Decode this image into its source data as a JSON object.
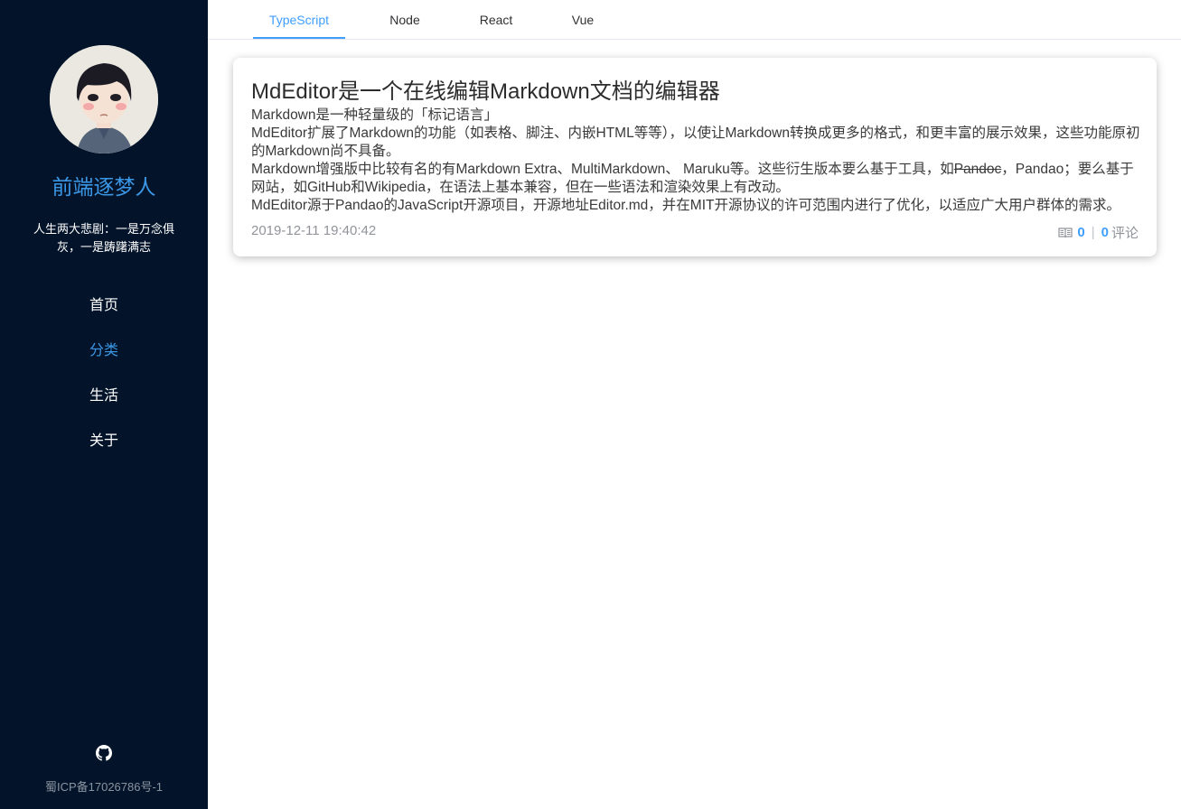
{
  "sidebar": {
    "site_name": "前端逐梦人",
    "motto": "人生两大悲剧：一是万念俱灰，一是踌躇满志",
    "nav": [
      "首页",
      "分类",
      "生活",
      "关于"
    ],
    "active_nav": "分类",
    "icp": "蜀ICP备17026786号-1",
    "github_icon": "github-icon"
  },
  "tabs": {
    "items": [
      "TypeScript",
      "Node",
      "React",
      "Vue"
    ],
    "active": "TypeScript"
  },
  "article": {
    "title": "MdEditor是一个在线编辑Markdown文档的编辑器",
    "p1": "Markdown是一种轻量级的「标记语言」",
    "p2": "MdEditor扩展了Markdown的功能（如表格、脚注、内嵌HTML等等），以使让Markdown转换成更多的格式，和更丰富的展示效果，这些功能原初的Markdown尚不具备。",
    "p3_before": "Markdown增强版中比较有名的有Markdown Extra、MultiMarkdown、 Maruku等。这些衍生版本要么基于工具，如",
    "p3_strike": "Pandoc",
    "p3_after": "，Pandao；要么基于网站，如GitHub和Wikipedia，在语法上基本兼容，但在一些语法和渲染效果上有改动。",
    "p4": "MdEditor源于Pandao的JavaScript开源项目，开源地址Editor.md，并在MIT开源协议的许可范围内进行了优化，以适应广大用户群体的需求。",
    "date": "2019-12-11 19:40:42",
    "views": "0",
    "comments": "0",
    "comments_label": "评论",
    "views_icon": "book-icon"
  }
}
